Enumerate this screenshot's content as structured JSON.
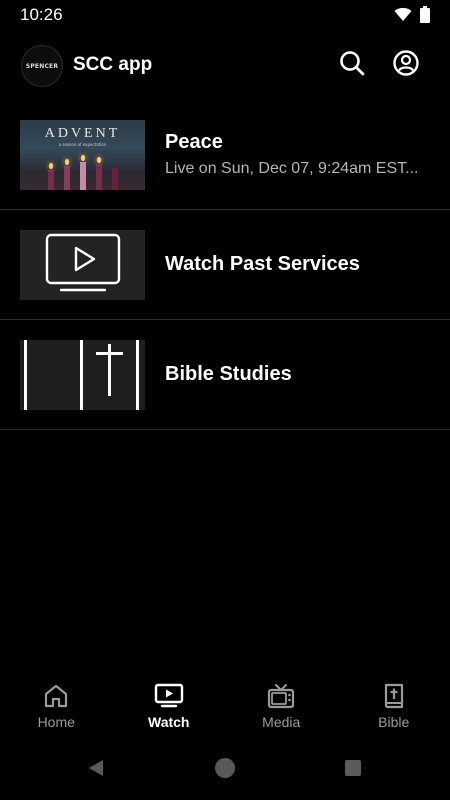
{
  "status_bar": {
    "time": "10:26"
  },
  "app_bar": {
    "title": "SCC app",
    "logo_text": "SPENCER"
  },
  "items": [
    {
      "title": "Peace",
      "subtitle": "Live on Sun, Dec 07, 9:24am EST...",
      "thumb": {
        "heading": "ADVENT",
        "tagline": "a season of expectation"
      }
    },
    {
      "title": "Watch Past Services"
    },
    {
      "title": "Bible Studies"
    }
  ],
  "nav": [
    {
      "label": "Home",
      "icon": "home-icon"
    },
    {
      "label": "Watch",
      "icon": "tv-play-icon",
      "active": true
    },
    {
      "label": "Media",
      "icon": "tv-icon"
    },
    {
      "label": "Bible",
      "icon": "bible-icon"
    }
  ],
  "colors": {
    "background": "#000000",
    "text": "#ffffff",
    "muted": "#9a9a9a",
    "divider": "#2e2e2e"
  }
}
